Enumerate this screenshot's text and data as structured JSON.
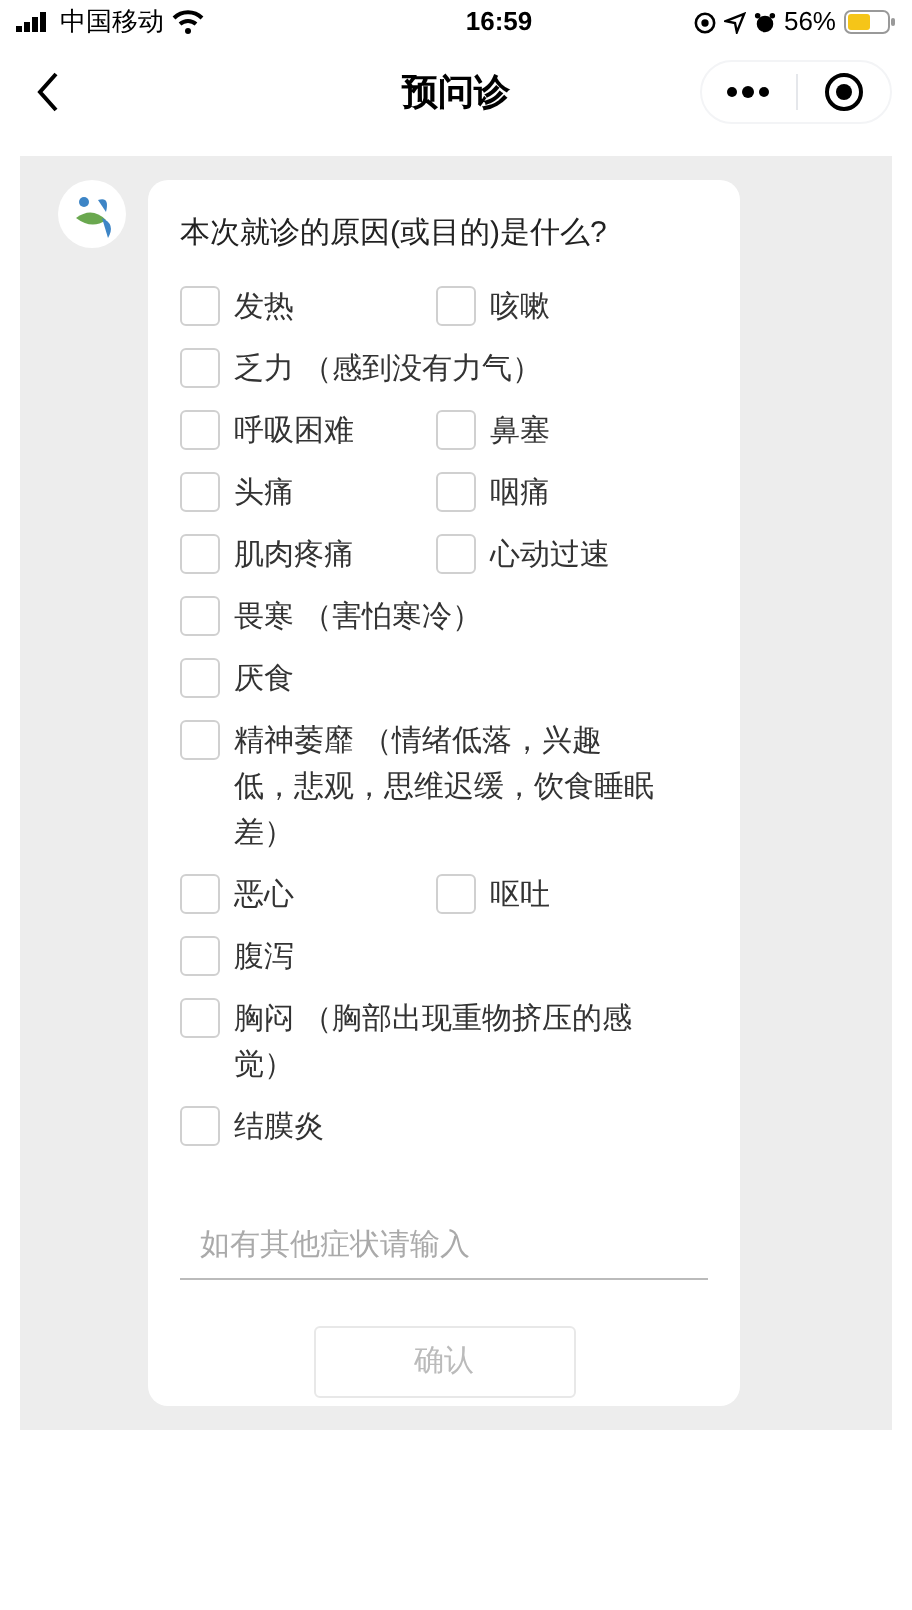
{
  "status_bar": {
    "carrier": "中国移动",
    "time": "16:59",
    "battery": "56%"
  },
  "nav": {
    "title": "预问诊"
  },
  "question": "本次就诊的原因(或目的)是什么?",
  "option_rows": [
    [
      {
        "label": "发热",
        "checked": false
      },
      {
        "label": "咳嗽",
        "checked": false
      }
    ],
    [
      {
        "label": "乏力 （感到没有力气）",
        "checked": false
      }
    ],
    [
      {
        "label": "呼吸困难",
        "checked": false
      },
      {
        "label": "鼻塞",
        "checked": false
      }
    ],
    [
      {
        "label": "头痛",
        "checked": false
      },
      {
        "label": "咽痛",
        "checked": false
      }
    ],
    [
      {
        "label": "肌肉疼痛",
        "checked": false
      },
      {
        "label": "心动过速",
        "checked": false
      }
    ],
    [
      {
        "label": "畏寒 （害怕寒冷）",
        "checked": false
      }
    ],
    [
      {
        "label": "厌食",
        "checked": false
      }
    ],
    [
      {
        "label": "精神萎靡 （情绪低落，兴趣低，悲观，思维迟缓，饮食睡眠差）",
        "checked": false
      }
    ],
    [
      {
        "label": "恶心",
        "checked": false
      },
      {
        "label": "呕吐",
        "checked": false
      }
    ],
    [
      {
        "label": "腹泻",
        "checked": false
      }
    ],
    [
      {
        "label": "胸闷 （胸部出现重物挤压的感觉）",
        "checked": false
      }
    ],
    [
      {
        "label": "结膜炎",
        "checked": false
      }
    ]
  ],
  "other_input": {
    "placeholder": "如有其他症状请输入"
  },
  "confirm_button": {
    "label": "确认",
    "disabled": true
  }
}
